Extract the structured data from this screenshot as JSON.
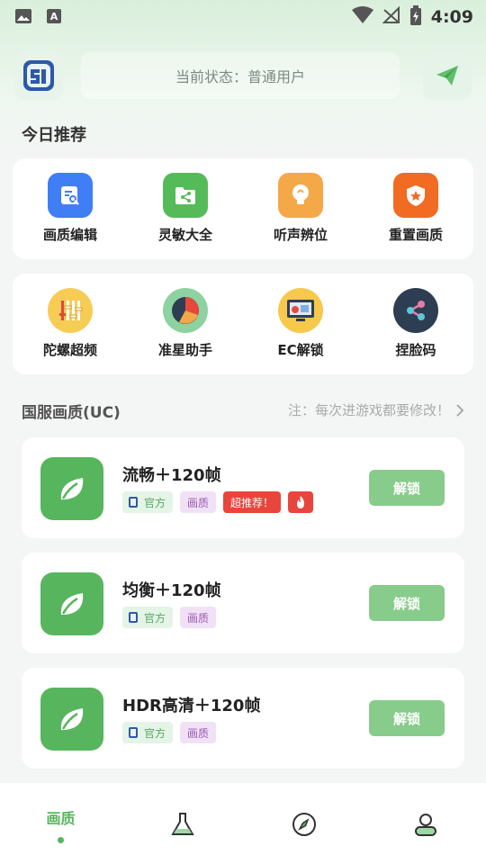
{
  "status_bar": {
    "time": "4:09"
  },
  "header": {
    "status_text": "当前状态：普通用户"
  },
  "today": {
    "title": "今日推荐",
    "row1": [
      {
        "label": "画质编辑",
        "icon": "image-edit-icon",
        "color": "#3f7ef5"
      },
      {
        "label": "灵敏大全",
        "icon": "share-folder-icon",
        "color": "#55bb59"
      },
      {
        "label": "听声辨位",
        "icon": "bulb-icon",
        "color": "#f4a847"
      },
      {
        "label": "重置画质",
        "icon": "shield-star-icon",
        "color": "#f26b22"
      }
    ],
    "row2": [
      {
        "label": "陀螺超频",
        "icon": "equalizer-icon",
        "color": "#f7cc55"
      },
      {
        "label": "准星助手",
        "icon": "pie-chart-icon",
        "color": "#8dd2a0"
      },
      {
        "label": "EC解锁",
        "icon": "monitor-icon",
        "color": "#f6c84c"
      },
      {
        "label": "捏脸码",
        "icon": "share-nodes-icon",
        "color": "#2e3e52"
      }
    ]
  },
  "cn_server": {
    "title": "国服画质(UC)",
    "note": "注：每次进游戏都要修改！"
  },
  "items": [
    {
      "title": "流畅＋120帧",
      "tag_official": "官方",
      "tag_quality": "画质",
      "tag_hot": "超推荐！",
      "button": "解锁"
    },
    {
      "title": "均衡＋120帧",
      "tag_official": "官方",
      "tag_quality": "画质",
      "button": "解锁"
    },
    {
      "title": "HDR高清＋120帧",
      "tag_official": "官方",
      "tag_quality": "画质",
      "button": "解锁"
    }
  ],
  "bottom_nav": [
    {
      "label": "画质",
      "active": true,
      "icon": "quality-tab"
    },
    {
      "icon": "flask-icon"
    },
    {
      "icon": "compass-icon"
    },
    {
      "icon": "user-icon"
    }
  ],
  "colors": {
    "accent": "#57b65d",
    "unlock": "#88cc8c",
    "hot": "#e8453c"
  }
}
